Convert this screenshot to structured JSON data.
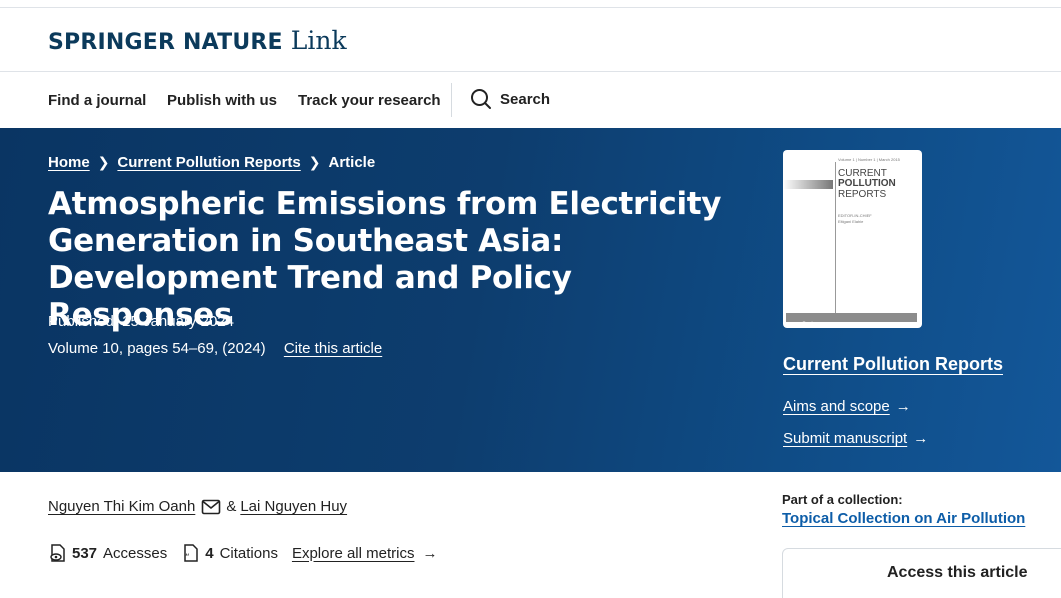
{
  "header": {
    "brand_main": "SPRINGER NATURE",
    "brand_sub": "Link"
  },
  "nav": {
    "find_journal": "Find a journal",
    "publish": "Publish with us",
    "track": "Track your research",
    "search": "Search"
  },
  "breadcrumb": {
    "home": "Home",
    "journal": "Current Pollution Reports",
    "current": "Article"
  },
  "article": {
    "title": "Atmospheric Emissions from Electricity Generation in Southeast Asia: Development Trend and Policy Responses",
    "published": "Published: 25 January 2024",
    "volume": "Volume 10, pages 54–69, (2024)",
    "cite": "Cite this article"
  },
  "journal_panel": {
    "cover": {
      "vol_line": "Volume 1 | Number 1 | March 2015",
      "title_1": "CURRENT",
      "title_2": "POLLUTION",
      "title_3": "REPORTS",
      "editor_label": "EDITOR-IN-CHIEF",
      "editor_name": "Eltigani Elahie",
      "publisher": "Springer"
    },
    "name": "Current Pollution Reports",
    "aims": "Aims and scope",
    "submit": "Submit manuscript"
  },
  "authors": {
    "author1": "Nguyen Thi Kim Oanh",
    "amp": "&",
    "author2": "Lai Nguyen Huy"
  },
  "metrics": {
    "accesses_count": "537",
    "accesses_label": "Accesses",
    "citations_count": "4",
    "citations_label": "Citations",
    "explore": "Explore all metrics"
  },
  "collection": {
    "label": "Part of a collection:",
    "link": "Topical Collection on Air Pollution"
  },
  "access": {
    "label": "Access this article"
  },
  "colors": {
    "hero_dark": "#0a3563",
    "hero_light": "#135799",
    "brand": "#0b3a5b",
    "link_blue": "#0d5da8"
  }
}
